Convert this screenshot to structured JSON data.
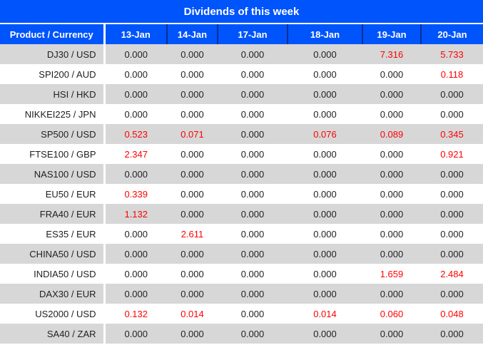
{
  "title": "Dividends of this week",
  "colors": {
    "header_bg": "#0054fb",
    "header_separator": "#0b2d91",
    "row_alt_bg": "#d7d7d7",
    "row_plain_bg": "#ffffff",
    "header_text": "#ffffff",
    "value_text": "#1f1f1f",
    "value_highlight": "#ff0000"
  },
  "table": {
    "columns": [
      "Product / Currency",
      "13-Jan",
      "14-Jan",
      "17-Jan",
      "18-Jan",
      "19-Jan",
      "20-Jan"
    ],
    "zero_value": "0.000",
    "rows": [
      {
        "product": "DJ30 / USD",
        "values": [
          "0.000",
          "0.000",
          "0.000",
          "0.000",
          "7.316",
          "5.733"
        ]
      },
      {
        "product": "SPI200 / AUD",
        "values": [
          "0.000",
          "0.000",
          "0.000",
          "0.000",
          "0.000",
          "0.118"
        ]
      },
      {
        "product": "HSI / HKD",
        "values": [
          "0.000",
          "0.000",
          "0.000",
          "0.000",
          "0.000",
          "0.000"
        ]
      },
      {
        "product": "NIKKEI225 / JPN",
        "values": [
          "0.000",
          "0.000",
          "0.000",
          "0.000",
          "0.000",
          "0.000"
        ]
      },
      {
        "product": "SP500 / USD",
        "values": [
          "0.523",
          "0.071",
          "0.000",
          "0.076",
          "0.089",
          "0.345"
        ]
      },
      {
        "product": "FTSE100 / GBP",
        "values": [
          "2.347",
          "0.000",
          "0.000",
          "0.000",
          "0.000",
          "0.921"
        ]
      },
      {
        "product": "NAS100 / USD",
        "values": [
          "0.000",
          "0.000",
          "0.000",
          "0.000",
          "0.000",
          "0.000"
        ]
      },
      {
        "product": "EU50 / EUR",
        "values": [
          "0.339",
          "0.000",
          "0.000",
          "0.000",
          "0.000",
          "0.000"
        ]
      },
      {
        "product": "FRA40 / EUR",
        "values": [
          "1.132",
          "0.000",
          "0.000",
          "0.000",
          "0.000",
          "0.000"
        ]
      },
      {
        "product": "ES35 / EUR",
        "values": [
          "0.000",
          "2.611",
          "0.000",
          "0.000",
          "0.000",
          "0.000"
        ]
      },
      {
        "product": "CHINA50 / USD",
        "values": [
          "0.000",
          "0.000",
          "0.000",
          "0.000",
          "0.000",
          "0.000"
        ]
      },
      {
        "product": "INDIA50 / USD",
        "values": [
          "0.000",
          "0.000",
          "0.000",
          "0.000",
          "1.659",
          "2.484"
        ]
      },
      {
        "product": "DAX30 / EUR",
        "values": [
          "0.000",
          "0.000",
          "0.000",
          "0.000",
          "0.000",
          "0.000"
        ]
      },
      {
        "product": "US2000 / USD",
        "values": [
          "0.132",
          "0.014",
          "0.000",
          "0.014",
          "0.060",
          "0.048"
        ]
      },
      {
        "product": "SA40 / ZAR",
        "values": [
          "0.000",
          "0.000",
          "0.000",
          "0.000",
          "0.000",
          "0.000"
        ]
      }
    ]
  }
}
